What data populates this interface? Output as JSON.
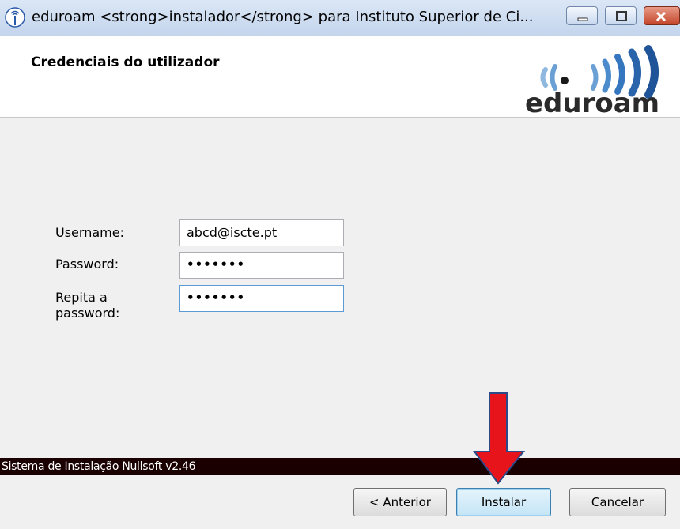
{
  "window": {
    "title": "eduroam <strong>instalador</strong>  para Instituto Superior de Ci..."
  },
  "header": {
    "title": "Credenciais do utilizador",
    "logo_text": "eduroam"
  },
  "form": {
    "username_label": "Username:",
    "username_value": "abcd@iscte.pt",
    "password_label": "Password:",
    "password_value": "•••••••",
    "repeat_label_line1": "Repita a",
    "repeat_label_line2": "password:",
    "repeat_value": "•••••••"
  },
  "footer": {
    "branding": "Sistema de Instalação Nullsoft v2.46",
    "back_button": "< Anterior",
    "install_button": "Instalar",
    "cancel_button": "Cancelar"
  },
  "colors": {
    "annotation_arrow": "#e8141c",
    "branding_bar": "#1a0000"
  }
}
